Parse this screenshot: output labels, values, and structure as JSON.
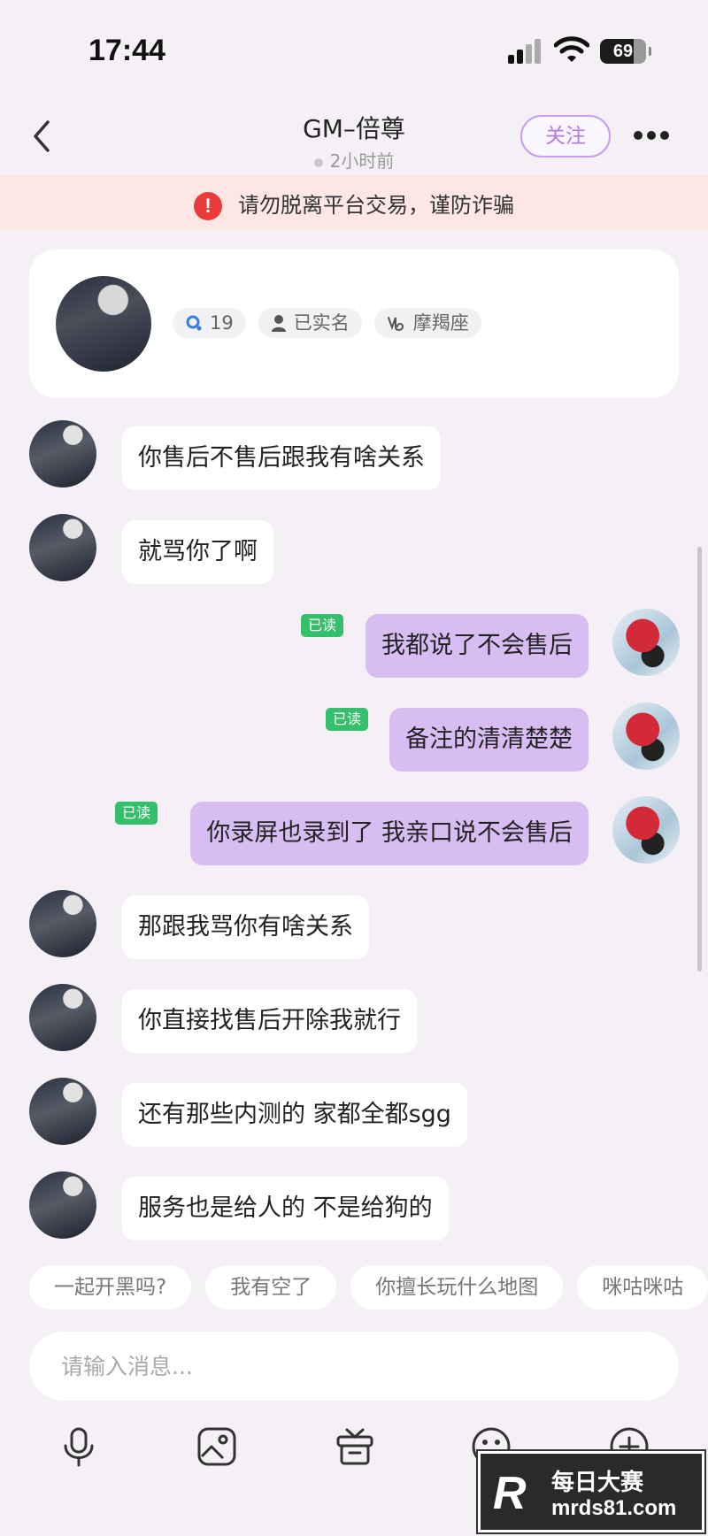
{
  "status_bar": {
    "time": "17:44",
    "battery": "69"
  },
  "nav": {
    "title": "GM–倍尊",
    "subtitle": "2小时前",
    "follow_label": "关注"
  },
  "warning": {
    "text": "请勿脱离平台交易，谨防诈骗"
  },
  "profile": {
    "tags": [
      {
        "icon": "level-icon",
        "label": "19"
      },
      {
        "icon": "person-icon",
        "label": "已实名"
      },
      {
        "icon": "capricorn-icon",
        "label": "摩羯座"
      }
    ]
  },
  "messages": [
    {
      "side": "left",
      "text": "你售后不售后跟我有啥关系"
    },
    {
      "side": "left",
      "text": "就骂你了啊"
    },
    {
      "side": "right",
      "text": "我都说了不会售后",
      "status": "已读"
    },
    {
      "side": "right",
      "text": "备注的清清楚楚",
      "status": "已读"
    },
    {
      "side": "right",
      "text": "你录屏也录到了 我亲口说不会售后",
      "status": "已读"
    },
    {
      "side": "left",
      "text": "那跟我骂你有啥关系"
    },
    {
      "side": "left",
      "text": "你直接找售后开除我就行"
    },
    {
      "side": "left",
      "text": "还有那些内测的 家都全都sgg"
    },
    {
      "side": "left",
      "text": "服务也是给人的  不是给狗的"
    }
  ],
  "quick_replies": [
    "一起开黑吗?",
    "我有空了",
    "你擅长玩什么地图",
    "咪咕咪咕"
  ],
  "input": {
    "placeholder": "请输入消息..."
  },
  "toolbar": {
    "icons": [
      "microphone-icon",
      "image-icon",
      "gift-icon",
      "emoji-icon",
      "plus-icon"
    ]
  },
  "watermark": {
    "logo": "R",
    "cn_text": "每日大赛",
    "url": "mrds81.com"
  }
}
